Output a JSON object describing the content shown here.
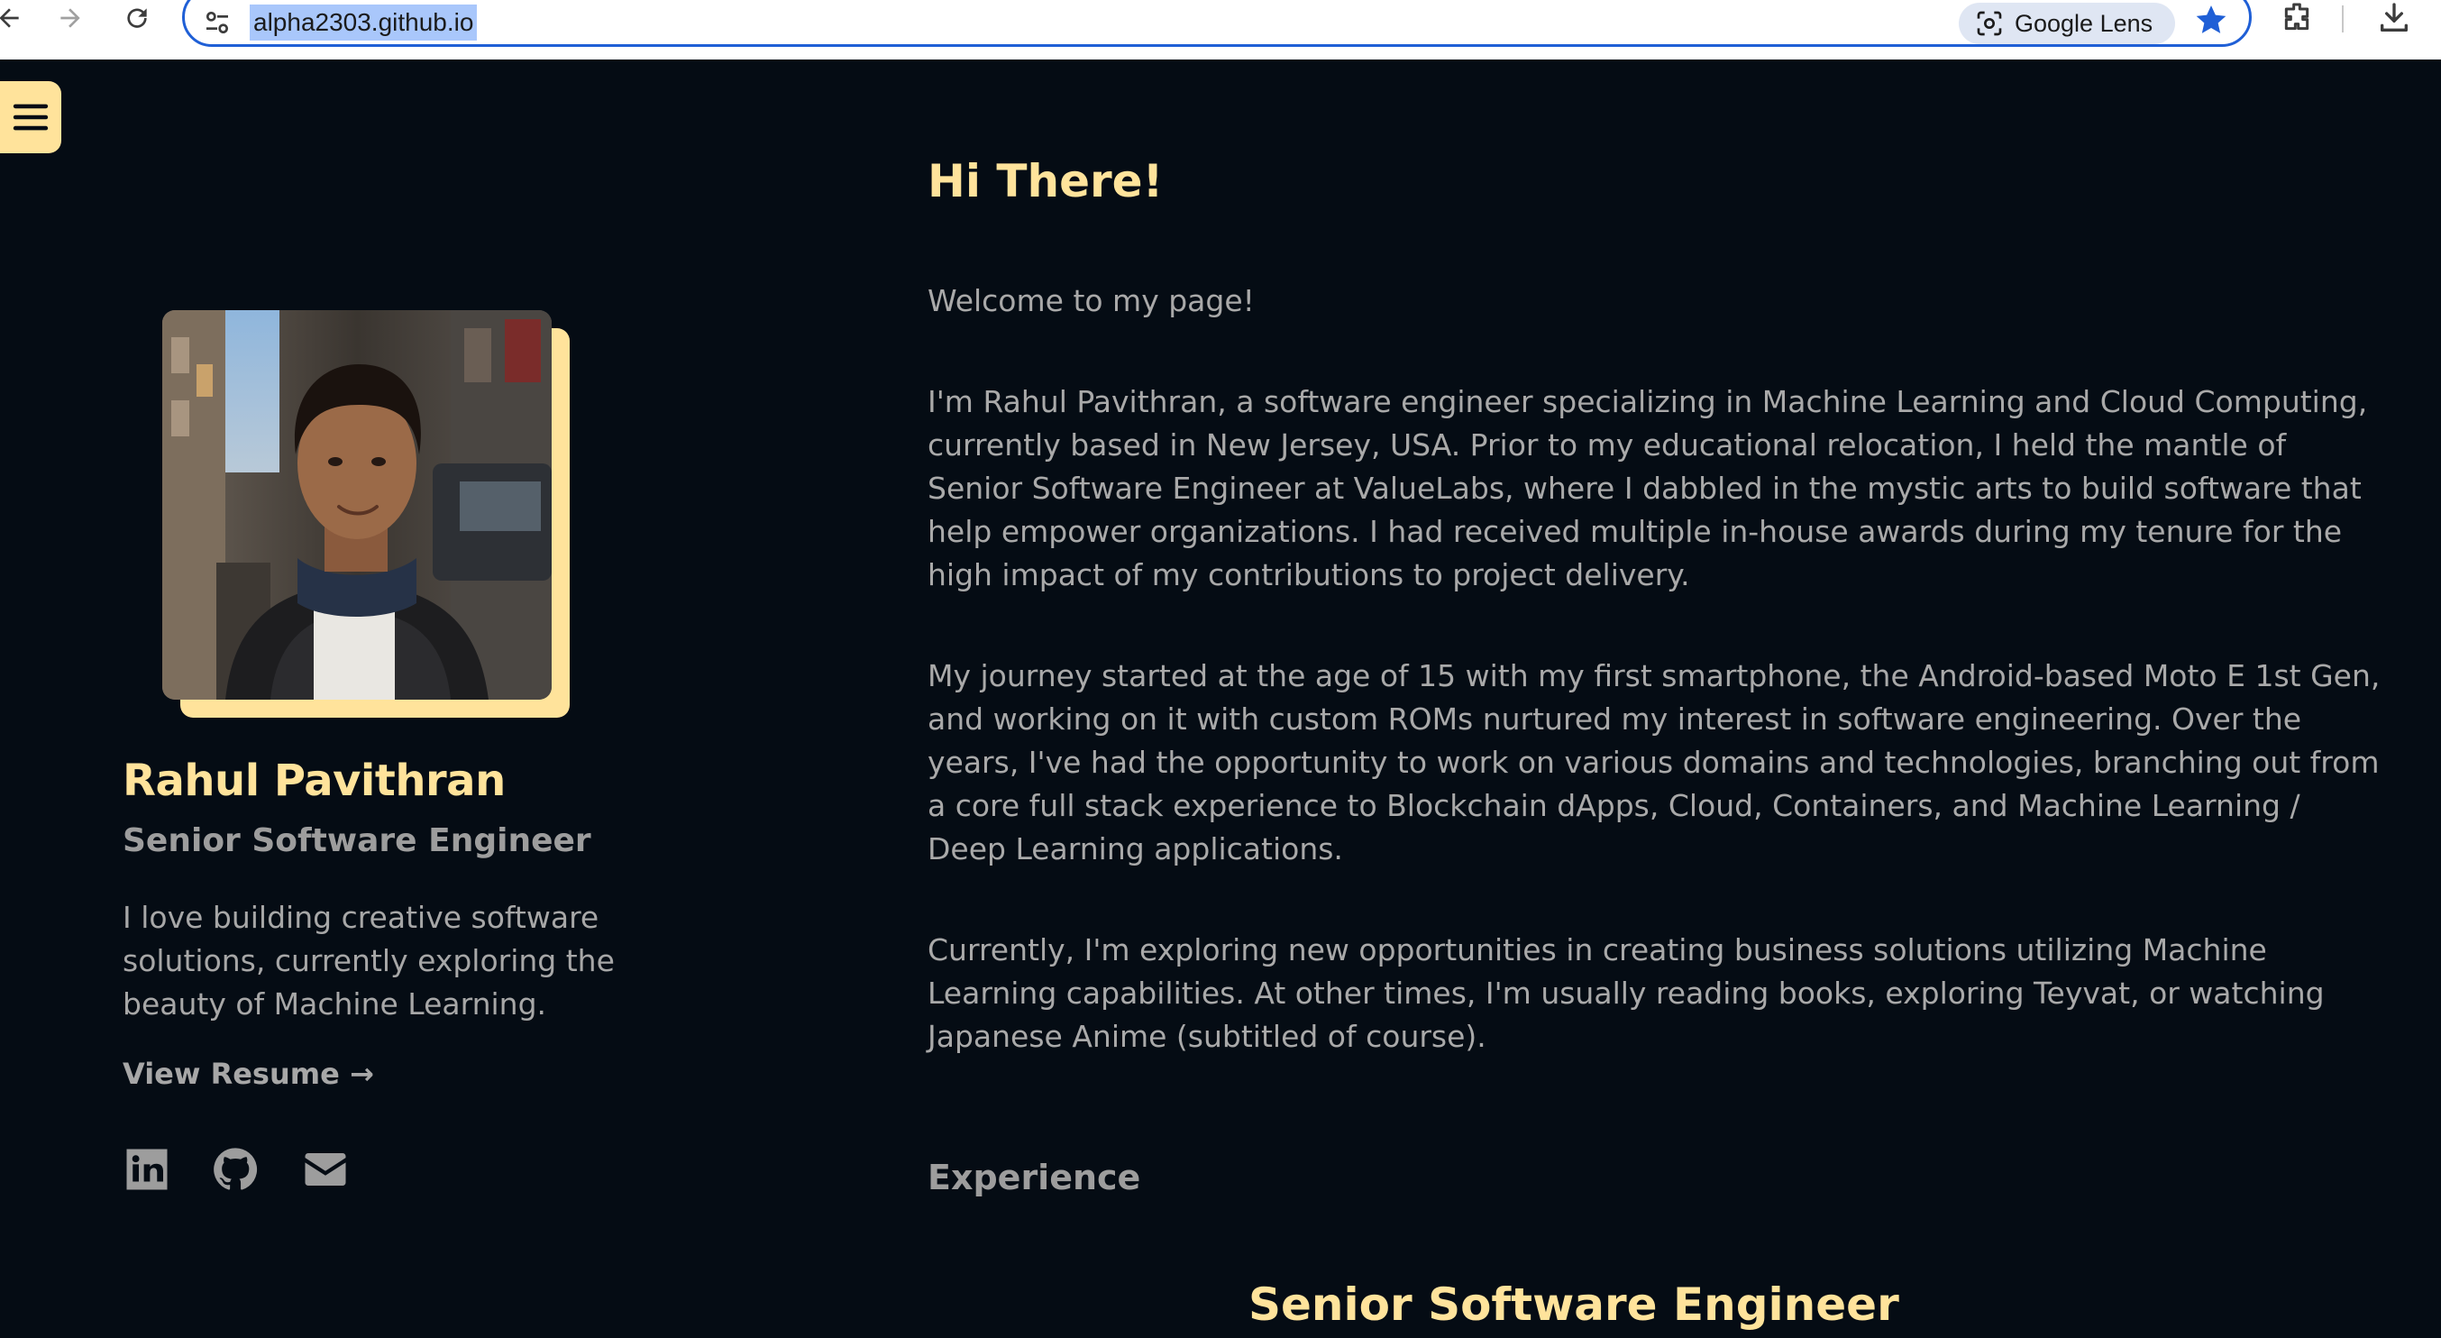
{
  "browser": {
    "url": "alpha2303.github.io",
    "lens_label": "Google Lens"
  },
  "sidebar": {
    "name": "Rahul Pavithran",
    "role": "Senior Software Engineer",
    "bio": "I love building creative software solutions, currently exploring the beauty of Machine Learning.",
    "resume_link": "View Resume →",
    "social_icons": [
      "linkedin-icon",
      "github-icon",
      "email-icon"
    ]
  },
  "main": {
    "greeting": "Hi There!",
    "paragraphs": [
      "Welcome to my page!",
      "I'm Rahul Pavithran, a software engineer specializing in Machine Learning and Cloud Computing, currently based in New Jersey, USA. Prior to my educational relocation, I held the mantle of Senior Software Engineer at ValueLabs, where I dabbled in the mystic arts to build software that help empower organizations. I had received multiple in-house awards during my tenure for the high impact of my contributions to project delivery.",
      "My journey started at the age of 15 with my first smartphone, the Android-based Moto E 1st Gen, and working on it with custom ROMs nurtured my interest in software engineering. Over the years, I've had the opportunity to work on various domains and technologies, branching out from a core full stack experience to Blockchain dApps, Cloud, Containers, and Machine Learning / Deep Learning applications.",
      "Currently, I'm exploring new opportunities in creating business solutions utilizing Machine Learning capabilities. At other times, I'm usually reading books, exploring Teyvat, or watching Japanese Anime (subtitled of course)."
    ],
    "experience_heading": "Experience",
    "experience_title": "Senior Software Engineer"
  },
  "colors": {
    "background": "#050c14",
    "accent": "#ffe39b",
    "text": "#a9a9a9"
  }
}
